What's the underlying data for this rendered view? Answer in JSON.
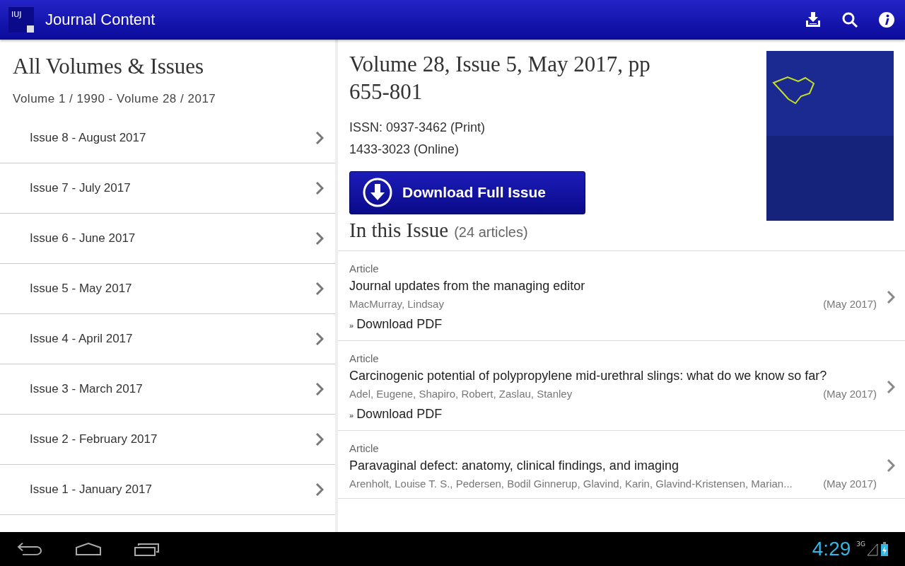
{
  "app_bar": {
    "logo_text": "IUJ",
    "title": "Journal Content"
  },
  "sidebar": {
    "heading": "All Volumes & Issues",
    "range": "Volume 1 / 1990 - Volume 28 / 2017",
    "issues": [
      {
        "label": "Issue 8 - August 2017"
      },
      {
        "label": "Issue 7 - July 2017"
      },
      {
        "label": "Issue 6 - June 2017"
      },
      {
        "label": "Issue 5 - May 2017"
      },
      {
        "label": "Issue 4 - April 2017"
      },
      {
        "label": "Issue 3 - March 2017"
      },
      {
        "label": "Issue 2 - February 2017"
      },
      {
        "label": "Issue 1 - January 2017"
      }
    ]
  },
  "issue": {
    "title": "Volume 28, Issue 5, May 2017, pp 655-801",
    "issn_print": "ISSN: 0937-3462 (Print)",
    "issn_online": "1433-3023 (Online)",
    "download_button": "Download Full Issue",
    "section_title": "In this Issue",
    "article_count": "(24 articles)"
  },
  "articles": [
    {
      "type": "Article",
      "title": "Journal updates from the managing editor",
      "authors": "MacMurray, Lindsay",
      "date": "(May 2017)",
      "marker": "»",
      "download": "Download PDF"
    },
    {
      "type": "Article",
      "title": "Carcinogenic potential of polypropylene mid-urethral slings: what do we know so far?",
      "authors": "Adel, Eugene, Shapiro, Robert, Zaslau, Stanley",
      "date": "(May 2017)",
      "marker": "»",
      "download": "Download PDF"
    },
    {
      "type": "Article",
      "title": "Paravaginal defect: anatomy, clinical findings, and imaging",
      "authors": "Arenholt, Louise T. S., Pedersen, Bodil Ginnerup, Glavind, Karin, Glavind-Kristensen, Marian...",
      "date": "(May 2017)"
    }
  ],
  "status_bar": {
    "time": "4:29",
    "network": "3G"
  }
}
